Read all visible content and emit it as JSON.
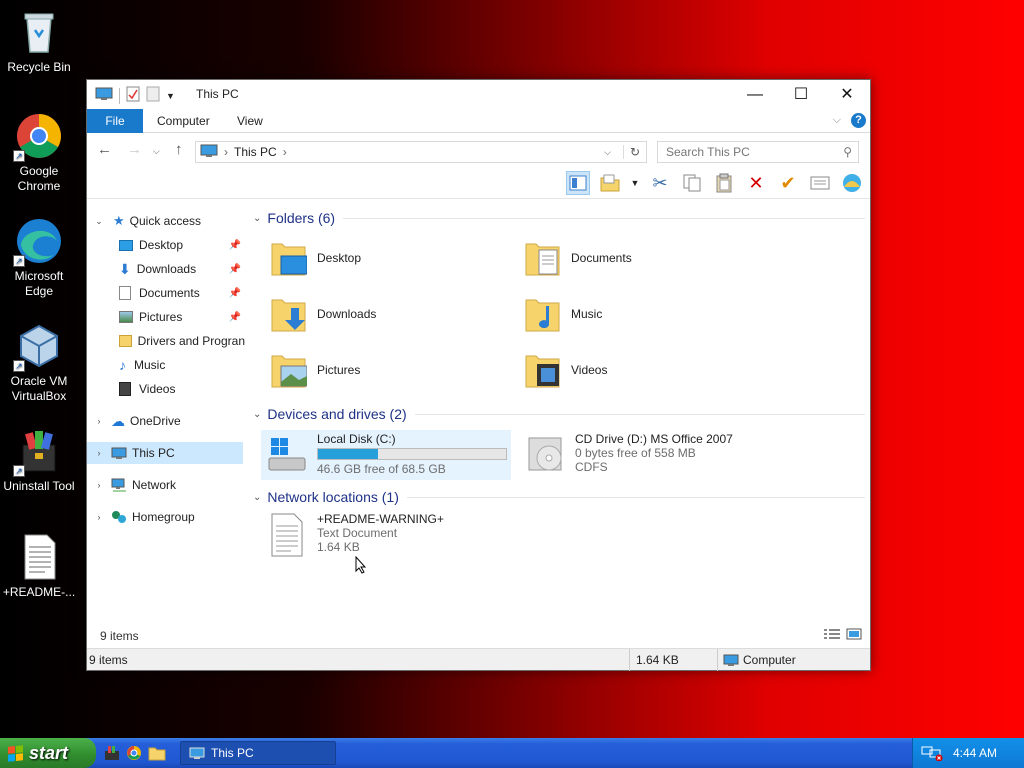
{
  "desktop": {
    "icons": [
      {
        "label": "Recycle Bin"
      },
      {
        "label": "Google Chrome"
      },
      {
        "label": "Microsoft Edge"
      },
      {
        "label": "Oracle VM VirtualBox"
      },
      {
        "label": "Uninstall Tool"
      },
      {
        "label": "+README-..."
      }
    ]
  },
  "window": {
    "title": "This PC",
    "tabs": {
      "file": "File",
      "computer": "Computer",
      "view": "View"
    },
    "address": {
      "location": "This PC"
    },
    "search": {
      "placeholder": "Search This PC"
    },
    "nav_pane": {
      "quick_access": "Quick access",
      "items": [
        {
          "label": "Desktop"
        },
        {
          "label": "Downloads"
        },
        {
          "label": "Documents"
        },
        {
          "label": "Pictures"
        },
        {
          "label": "Drivers and Progran"
        },
        {
          "label": "Music"
        },
        {
          "label": "Videos"
        }
      ],
      "onedrive": "OneDrive",
      "this_pc": "This PC",
      "network": "Network",
      "homegroup": "Homegroup"
    },
    "content": {
      "folders_header": "Folders (6)",
      "folders": [
        {
          "label": "Desktop"
        },
        {
          "label": "Documents"
        },
        {
          "label": "Downloads"
        },
        {
          "label": "Music"
        },
        {
          "label": "Pictures"
        },
        {
          "label": "Videos"
        }
      ],
      "devices_header": "Devices and drives (2)",
      "local_disk": {
        "name": "Local Disk (C:)",
        "free": "46.6 GB free of 68.5 GB",
        "used_fraction": 0.32
      },
      "cd_drive": {
        "name": "CD Drive (D:) MS Office 2007",
        "free": "0 bytes free of 558 MB",
        "fs": "CDFS"
      },
      "network_header": "Network locations (1)",
      "network_item": {
        "name": "+README-WARNING+",
        "type": "Text Document",
        "size": "1.64 KB"
      }
    },
    "status": {
      "items": "9 items",
      "bar_items": "9 items",
      "size": "1.64 KB",
      "location": "Computer"
    }
  },
  "taskbar": {
    "start": "start",
    "task": "This PC",
    "clock": "4:44 AM"
  }
}
